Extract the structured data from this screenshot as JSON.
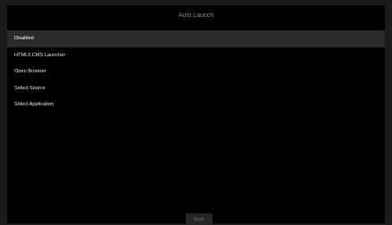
{
  "window": {
    "title": "Auto Launch"
  },
  "menu": {
    "items": [
      {
        "label": "Disabled",
        "selected": true
      },
      {
        "label": "HTML5 CMS Launcher",
        "selected": false
      },
      {
        "label": "Open Browser",
        "selected": false
      },
      {
        "label": "Select Source",
        "selected": false
      },
      {
        "label": "Select Application",
        "selected": false
      }
    ]
  },
  "footer": {
    "back_label": "Back"
  },
  "colors": {
    "background": "#000000",
    "selected_row": "#2a2a2a",
    "title_text": "#8c8c8c",
    "item_text": "#e6e6e6"
  }
}
